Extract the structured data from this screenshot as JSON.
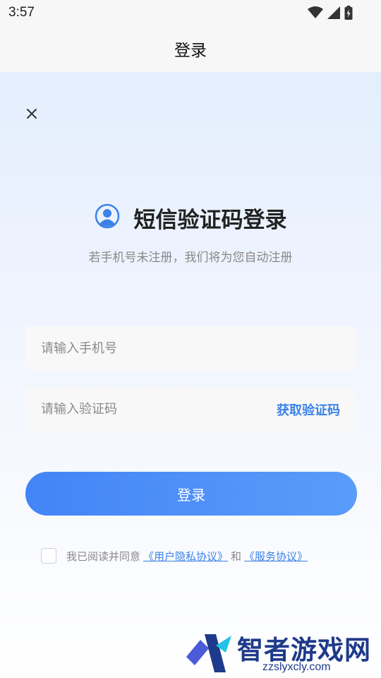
{
  "status_bar": {
    "time": "3:57"
  },
  "app_bar": {
    "title": "登录"
  },
  "heading": {
    "title": "短信验证码登录",
    "subtitle": "若手机号未注册，我们将为您自动注册"
  },
  "form": {
    "phone_placeholder": "请输入手机号",
    "code_placeholder": "请输入验证码",
    "get_code_label": "获取验证码",
    "login_label": "登录"
  },
  "agreement": {
    "prefix": "我已阅读并同意",
    "privacy_link": "《用户隐私协议》",
    "joiner": "和",
    "service_link": "《服务协议》",
    "checked": false
  },
  "colors": {
    "accent": "#3b82e8",
    "button_start": "#4384f7",
    "button_end": "#5a9cf8"
  },
  "watermark": {
    "name": "智者游戏网",
    "url": "zzslyxcly.com"
  }
}
